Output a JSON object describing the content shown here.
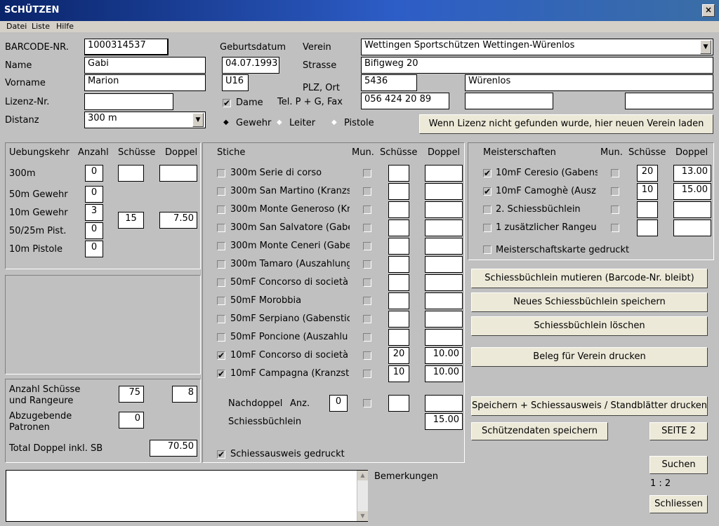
{
  "window": {
    "title": "SCHÜTZEN",
    "close_icon": "×"
  },
  "menu": [
    "Datei",
    "Liste",
    "Hilfe"
  ],
  "personal": {
    "barcode_label": "BARCODE-NR.",
    "barcode": "1000314537",
    "name_label": "Name",
    "name": "Gabi",
    "vorname_label": "Vorname",
    "vorname": "Marion",
    "lizenz_label": "Lizenz-Nr.",
    "lizenz": "",
    "distanz_label": "Distanz",
    "distanz": "300 m",
    "geburt_label": "Geburtsdatum",
    "geburt": "04.07.1993",
    "kategorie": "U16",
    "dame_label": "Dame",
    "verein_label": "Verein",
    "verein": "Wettingen  Sportschützen Wettingen-Würenlos",
    "strasse_label": "Strasse",
    "strasse": "Bifigweg 20",
    "plzort_label": "PLZ, Ort",
    "plz": "5436",
    "ort": "Würenlos",
    "tel_label": "Tel. P + G, Fax",
    "tel_p": "056 424 20 89",
    "tel_g": "",
    "fax": "",
    "weapon": {
      "gewehr": "Gewehr",
      "leiter": "Leiter",
      "pistole": "Pistole"
    },
    "new_club_button": "Wenn Lizenz nicht gefunden wurde, hier neuen Verein laden"
  },
  "uebung": {
    "header": {
      "title": "Uebungskehr",
      "anzahl": "Anzahl",
      "schuesse": "Schüsse",
      "doppel": "Doppel"
    },
    "rows": [
      {
        "label": "300m",
        "anzahl": "0"
      },
      {
        "label": "50m Gewehr",
        "anzahl": "0"
      },
      {
        "label": "10m Gewehr",
        "anzahl": "3"
      },
      {
        "label": "50/25m Pist.",
        "anzahl": "0"
      },
      {
        "label": "10m Pistole",
        "anzahl": "0"
      }
    ],
    "r300_schuesse": "",
    "r300_doppel": "",
    "group_schuesse": "15",
    "group_doppel": "7.50"
  },
  "totals": {
    "anzahl_label_1": "Anzahl Schüsse",
    "anzahl_label_2": "und Rangeure",
    "anzahl_schuesse": "75",
    "rangeure": "8",
    "patronen_label_1": "Abzugebende",
    "patronen_label_2": "Patronen",
    "patronen": "0",
    "total_label": "Total Doppel inkl. SB",
    "total": "70.50"
  },
  "stiche": {
    "header": {
      "title": "Stiche",
      "mun": "Mun.",
      "schuesse": "Schüsse",
      "doppel": "Doppel"
    },
    "rows": [
      {
        "label": "300m Serie di corso",
        "checked": "",
        "schuesse": "",
        "doppel": ""
      },
      {
        "label": "300m San Martino (Kranzst",
        "checked": "",
        "schuesse": "",
        "doppel": ""
      },
      {
        "label": "300m Monte Generoso (Kr",
        "checked": "",
        "schuesse": "",
        "doppel": ""
      },
      {
        "label": "300m San Salvatore (Gabe",
        "checked": "",
        "schuesse": "",
        "doppel": ""
      },
      {
        "label": "300m Monte Ceneri (Gabe",
        "checked": "",
        "schuesse": "",
        "doppel": ""
      },
      {
        "label": "300m Tamaro (Auszahlung",
        "checked": "",
        "schuesse": "",
        "doppel": ""
      },
      {
        "label": "50mF Concorso di società",
        "checked": "",
        "schuesse": "",
        "doppel": ""
      },
      {
        "label": "50mF Morobbia",
        "checked": "",
        "schuesse": "",
        "doppel": ""
      },
      {
        "label": "50mF Serpiano (Gabenstic",
        "checked": "",
        "schuesse": "",
        "doppel": ""
      },
      {
        "label": "50mF Poncione (Auszahlu",
        "checked": "",
        "schuesse": "",
        "doppel": ""
      },
      {
        "label": "10mF Concorso di società",
        "checked": "✔",
        "schuesse": "20",
        "doppel": "10.00"
      },
      {
        "label": "10mF Campagna (Kranzsti",
        "checked": "✔",
        "schuesse": "10",
        "doppel": "10.00"
      }
    ],
    "nachdoppel_label": "Nachdoppel",
    "anz_label": "Anz.",
    "nachdoppel_anz": "0",
    "nachdoppel_schuesse": "",
    "nachdoppel_doppel": "",
    "sb_label": "Schiessbüchlein",
    "sb_doppel": "15.00",
    "gedruckt_label": "Schiessausweis gedruckt"
  },
  "meister": {
    "header": {
      "title": "Meisterschaften",
      "mun": "Mun.",
      "schuesse": "Schüsse",
      "doppel": "Doppel"
    },
    "rows": [
      {
        "label": "10mF Ceresio (Gabens",
        "checked": "✔",
        "schuesse": "20",
        "doppel": "13.00"
      },
      {
        "label": "10mF Camoghè (Ausz",
        "checked": "✔",
        "schuesse": "10",
        "doppel": "15.00"
      },
      {
        "label": "2. Schiessbüchlein",
        "checked": "",
        "schuesse": "",
        "doppel": ""
      },
      {
        "label": "1 zusätzlicher Rangeu",
        "checked": "",
        "schuesse": "",
        "doppel": ""
      }
    ],
    "karte_label": "Meisterschaftskarte gedruckt"
  },
  "buttons": {
    "mutieren": "Schiessbüchlein mutieren (Barcode-Nr. bleibt)",
    "neues": "Neues Schiessbüchlein speichern",
    "loeschen": "Schiessbüchlein löschen",
    "beleg": "Beleg für Verein drucken",
    "speichern_drucken": "Speichern + Schiessausweis / Standblätter drucken",
    "schuetzendaten": "Schützendaten speichern",
    "seite": "SEITE  2",
    "suchen": "Suchen",
    "ratio": "1 : 2",
    "schliessen": "Schliessen"
  },
  "bemerkungen_label": "Bemerkungen",
  "bemerkungen": ""
}
